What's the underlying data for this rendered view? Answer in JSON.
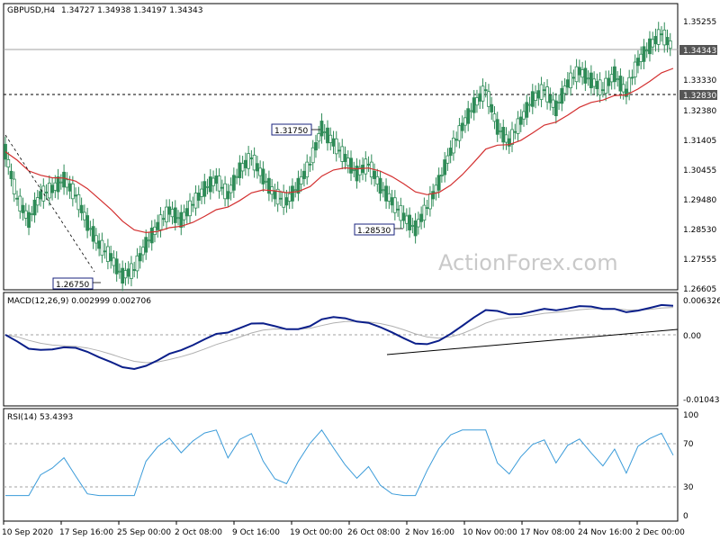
{
  "header": {
    "symbol": "GBPUSD,H4",
    "ohlc": "1.34727 1.34938 1.34197 1.34343"
  },
  "watermark": "ActionForex.com",
  "colors": {
    "candle": "#2e8b57",
    "ma": "#d32f2f",
    "macd": "#0b1f8a",
    "signal": "#b0b0b0",
    "rsi": "#3a9bd9",
    "grid": "#a0a0a0",
    "price_tag_bg": "#555555"
  },
  "price_panel": {
    "y_ticks": [
      "1.35255",
      "1.34343",
      "1.33330",
      "1.32830",
      "1.32380",
      "1.31405",
      "1.30455",
      "1.29480",
      "1.28530",
      "1.27555",
      "1.26605"
    ],
    "current_price": "1.34343",
    "level_line": "1.32830",
    "annotations": [
      {
        "label": "1.31750"
      },
      {
        "label": "1.28530"
      },
      {
        "label": "1.26750"
      }
    ]
  },
  "macd_panel": {
    "title": "MACD(12,26,9) 0.002999 0.002706",
    "y_ticks": [
      "0.006326",
      "0.00",
      "-0.010438"
    ]
  },
  "rsi_panel": {
    "title": "RSI(14) 53.4393",
    "y_ticks": [
      "100",
      "70",
      "30",
      "0"
    ]
  },
  "x_ticks": [
    "10 Sep 2020",
    "17 Sep 16:00",
    "25 Sep 00:00",
    "2 Oct 08:00",
    "9 Oct 16:00",
    "19 Oct 00:00",
    "26 Oct 08:00",
    "2 Nov 16:00",
    "10 Nov 00:00",
    "17 Nov 08:00",
    "24 Nov 16:00",
    "2 Dec 00:00"
  ],
  "chart_data": {
    "type": "line",
    "title": "GBPUSD,H4",
    "series": [
      {
        "name": "GBPUSD",
        "values": [
          1.31,
          1.295,
          1.288,
          1.296,
          1.298,
          1.301,
          1.296,
          1.287,
          1.28,
          1.276,
          1.27,
          1.272,
          1.28,
          1.286,
          1.291,
          1.288,
          1.293,
          1.298,
          1.301,
          1.296,
          1.304,
          1.308,
          1.302,
          1.296,
          1.294,
          1.299,
          1.306,
          1.3175,
          1.313,
          1.308,
          1.303,
          1.306,
          1.299,
          1.294,
          1.289,
          1.2853,
          1.292,
          1.3,
          1.31,
          1.318,
          1.325,
          1.33,
          1.318,
          1.313,
          1.32,
          1.327,
          1.33,
          1.324,
          1.332,
          1.336,
          1.333,
          1.33,
          1.335,
          1.329,
          1.339,
          1.344,
          1.348,
          1.3434
        ]
      }
    ],
    "x_ticks": [
      "10 Sep 2020",
      "17 Sep 16:00",
      "25 Sep 00:00",
      "2 Oct 08:00",
      "9 Oct 16:00",
      "19 Oct 00:00",
      "26 Oct 08:00",
      "2 Nov 16:00",
      "10 Nov 00:00",
      "17 Nov 08:00",
      "24 Nov 16:00",
      "2 Dec 00:00"
    ],
    "y_range": [
      1.26605,
      1.35255
    ],
    "grid": false
  }
}
